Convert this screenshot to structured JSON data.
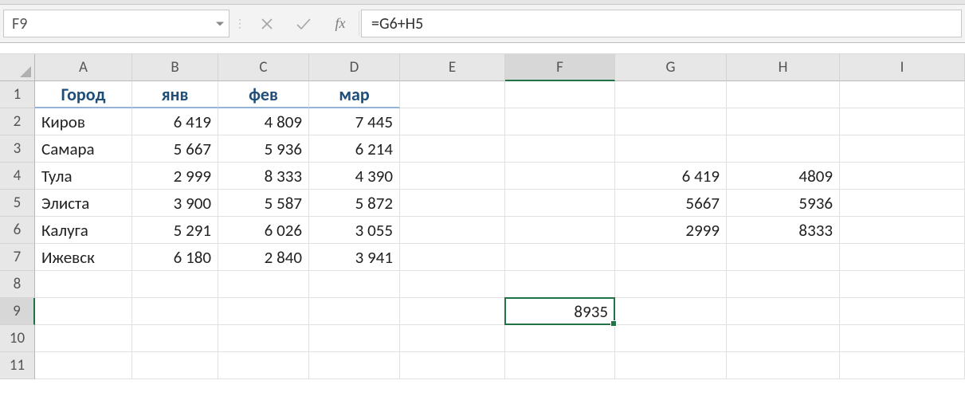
{
  "formulaBar": {
    "nameBox": "F9",
    "formula": "=G6+H5",
    "fxLabel": "fx"
  },
  "columns": [
    "A",
    "B",
    "C",
    "D",
    "E",
    "F",
    "G",
    "H",
    "I"
  ],
  "rows": [
    "1",
    "2",
    "3",
    "4",
    "5",
    "6",
    "7",
    "8",
    "9",
    "10",
    "11"
  ],
  "activeCol": "F",
  "activeRow": "9",
  "headersRow": {
    "A": "Город",
    "B": "янв",
    "C": "фев",
    "D": "мар"
  },
  "data": {
    "2": {
      "A": "Киров",
      "B": "6 419",
      "C": "4 809",
      "D": "7 445"
    },
    "3": {
      "A": "Самара",
      "B": "5 667",
      "C": "5 936",
      "D": "6 214"
    },
    "4": {
      "A": "Тула",
      "B": "2 999",
      "C": "8 333",
      "D": "4 390",
      "G": "6 419",
      "H": "4809"
    },
    "5": {
      "A": "Элиста",
      "B": "3 900",
      "C": "5 587",
      "D": "5 872",
      "G": "5667",
      "H": "5936"
    },
    "6": {
      "A": "Калуга",
      "B": "5 291",
      "C": "6 026",
      "D": "3 055",
      "G": "2999",
      "H": "8333"
    },
    "7": {
      "A": "Ижевск",
      "B": "6 180",
      "C": "2 840",
      "D": "3 941"
    },
    "9": {
      "F": "8935"
    }
  },
  "selectedCell": {
    "col": "F",
    "row": "9"
  }
}
